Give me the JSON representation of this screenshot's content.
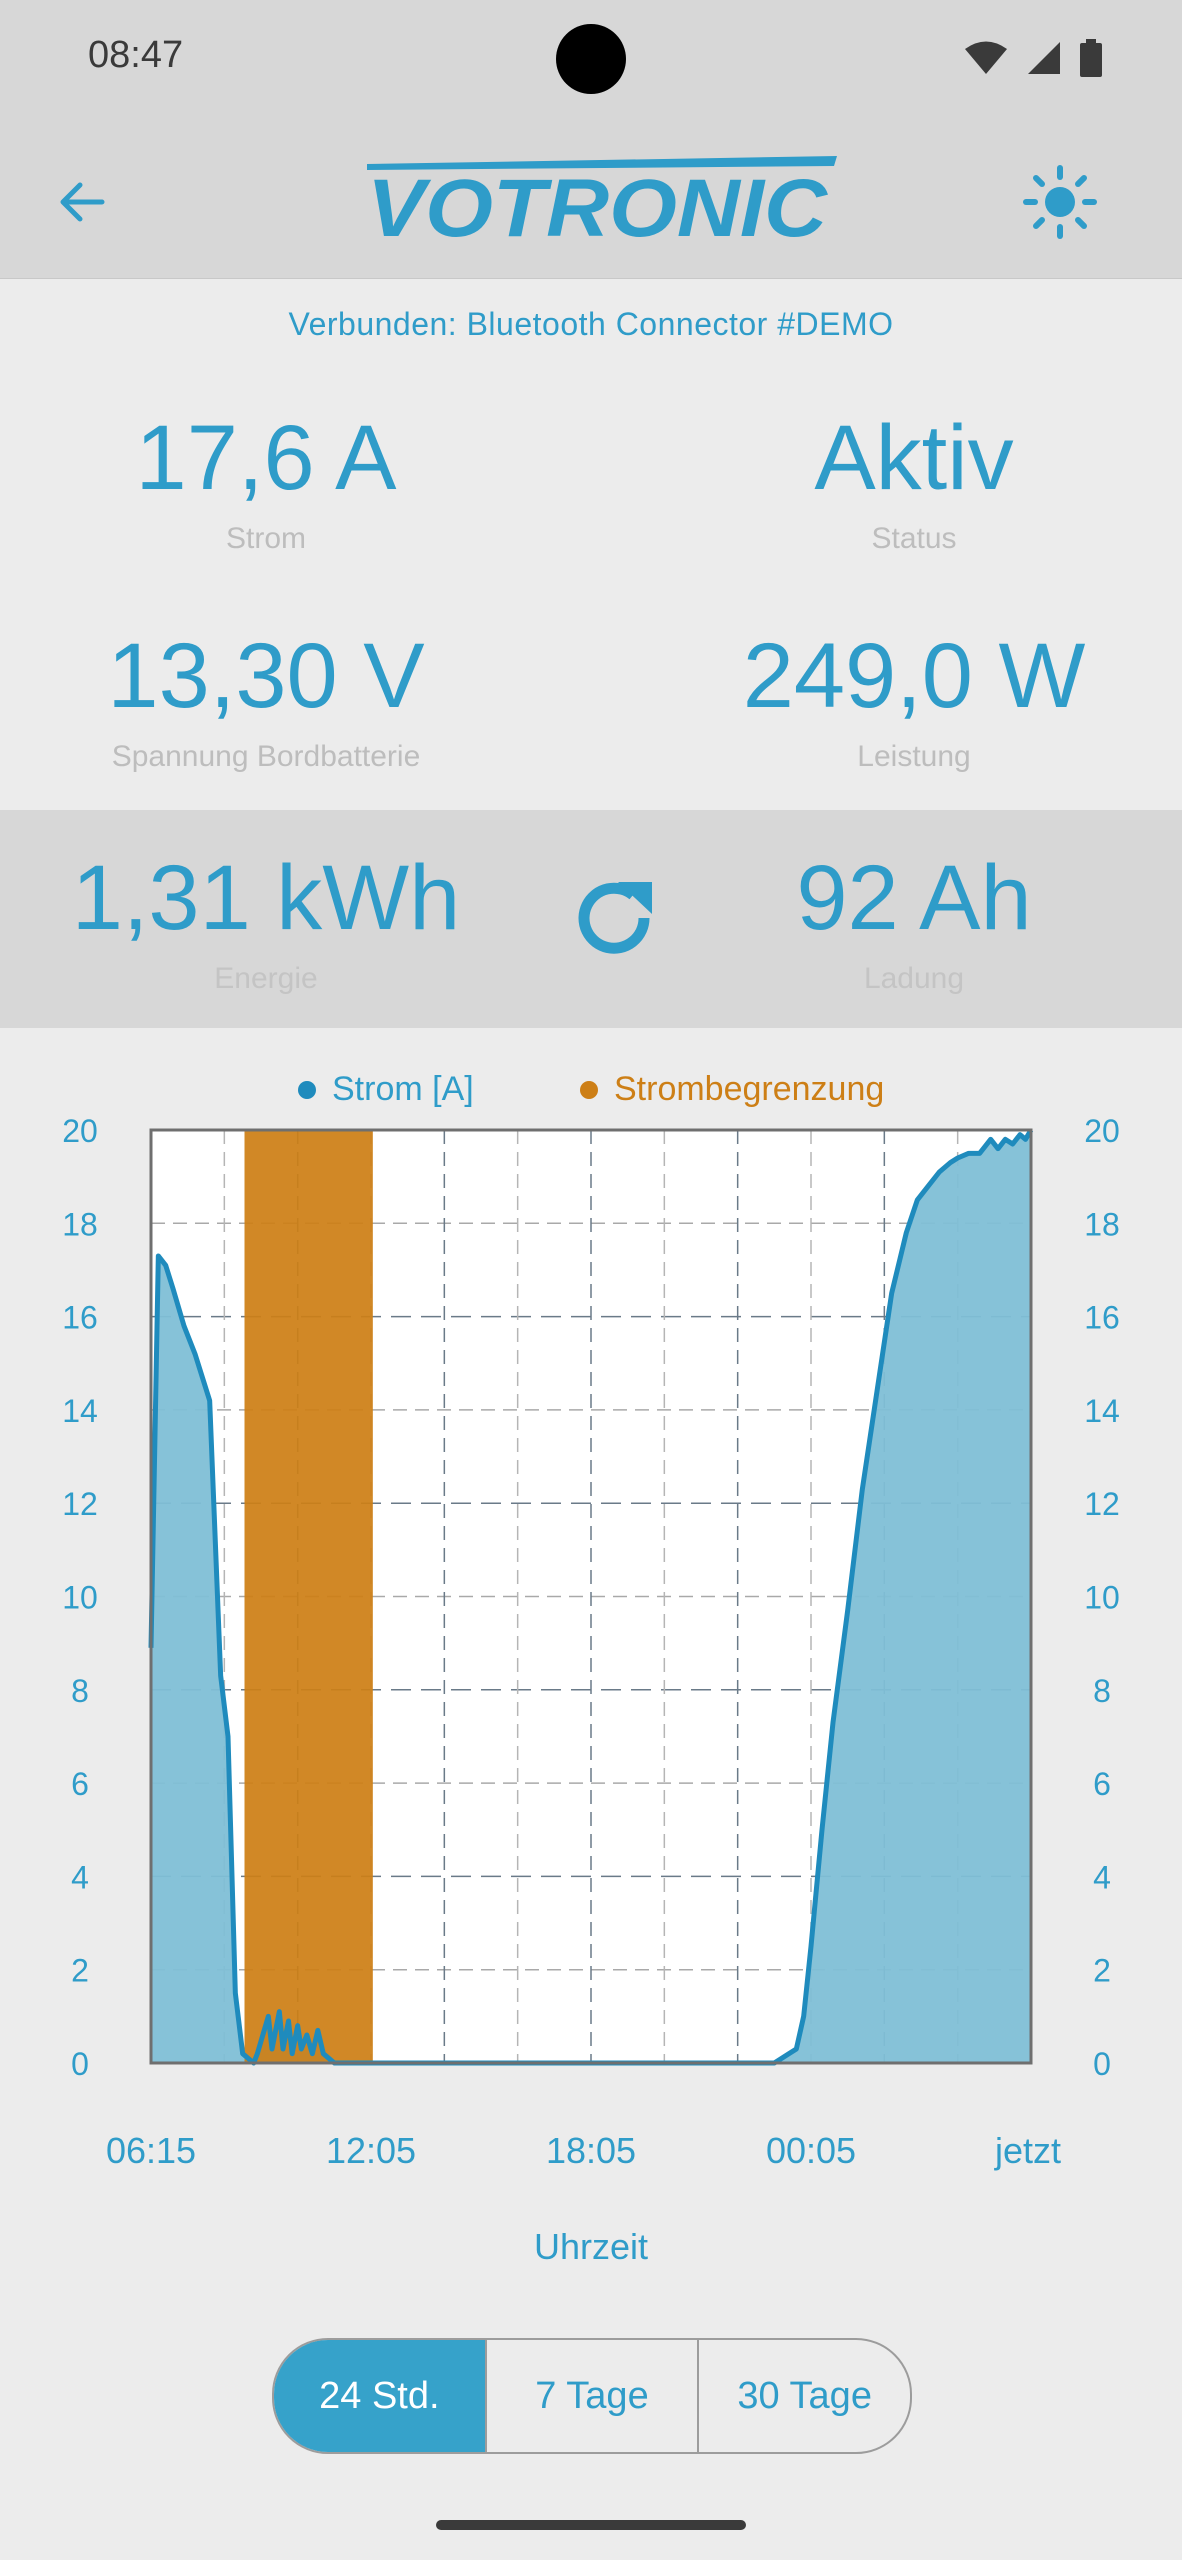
{
  "status_bar": {
    "time": "08:47",
    "icons": [
      "wifi-icon",
      "cellular-signal-icon",
      "battery-icon"
    ]
  },
  "header": {
    "brand": "VOTRONIC",
    "back_icon": "arrow-back-icon",
    "theme_icon": "sun-icon"
  },
  "connection": {
    "text": "Verbunden: Bluetooth Connector #DEMO"
  },
  "metrics": {
    "strom": {
      "value": "17,6 A",
      "label": "Strom"
    },
    "status": {
      "value": "Aktiv",
      "label": "Status"
    },
    "spannung": {
      "value": "13,30 V",
      "label": "Spannung Bordbatterie"
    },
    "leistung": {
      "value": "249,0 W",
      "label": "Leistung"
    },
    "energie": {
      "value": "1,31 kWh",
      "label": "Energie"
    },
    "ladung": {
      "value": "92 Ah",
      "label": "Ladung"
    }
  },
  "refresh_icon": "refresh-icon",
  "colors": {
    "accent": "#2f9cc9",
    "series_fill": "#7fbfd6",
    "series_line": "#1f8bbd",
    "limit": "#cd7f16"
  },
  "chart_data": {
    "type": "area",
    "legend": [
      "Strom [A]",
      "Strombegrenzung"
    ],
    "xlabel": "Uhrzeit",
    "x_tick_labels": [
      "06:15",
      "12:05",
      "18:05",
      "00:05",
      "jetzt"
    ],
    "y_ticks": [
      0,
      2,
      4,
      6,
      8,
      10,
      12,
      14,
      16,
      18,
      20
    ],
    "ylim": [
      0,
      20
    ],
    "xlim": [
      0,
      24
    ],
    "grid": true,
    "series": [
      {
        "name": "Strom [A]",
        "x": [
          0,
          0.2,
          0.4,
          0.6,
          0.9,
          1.2,
          1.6,
          1.9,
          2.1,
          2.3,
          2.5,
          2.8,
          2.9,
          3.2,
          3.3,
          3.5,
          3.6,
          3.75,
          3.85,
          4.0,
          4.1,
          4.25,
          4.4,
          4.55,
          4.7,
          4.85,
          5.0,
          5.2,
          6,
          10,
          14,
          17,
          17.4,
          17.6,
          17.8,
          18.0,
          18.3,
          18.6,
          19.0,
          19.4,
          19.8,
          20.2,
          20.6,
          20.9,
          21.2,
          21.5,
          21.8,
          22.0,
          22.3,
          22.6,
          22.9,
          23.1,
          23.3,
          23.5,
          23.7,
          23.85,
          24.0
        ],
        "y": [
          8.9,
          17.3,
          17.1,
          16.6,
          15.8,
          15.2,
          14.2,
          8.3,
          7.0,
          1.5,
          0.2,
          0.0,
          0.2,
          1.0,
          0.3,
          1.1,
          0.3,
          0.9,
          0.2,
          0.8,
          0.3,
          0.6,
          0.2,
          0.7,
          0.2,
          0.1,
          0,
          0,
          0,
          0,
          0,
          0,
          0.2,
          0.3,
          1.0,
          2.5,
          5.0,
          7.3,
          9.7,
          12.3,
          14.4,
          16.5,
          17.8,
          18.5,
          18.8,
          19.1,
          19.3,
          19.4,
          19.5,
          19.5,
          19.8,
          19.6,
          19.8,
          19.7,
          19.9,
          19.8,
          20.0
        ]
      },
      {
        "name": "Strombegrenzung",
        "ranges": [
          [
            2.55,
            6.05
          ]
        ]
      }
    ]
  },
  "range_selector": {
    "options": [
      "24 Std.",
      "7 Tage",
      "30 Tage"
    ],
    "selected": "24 Std."
  }
}
